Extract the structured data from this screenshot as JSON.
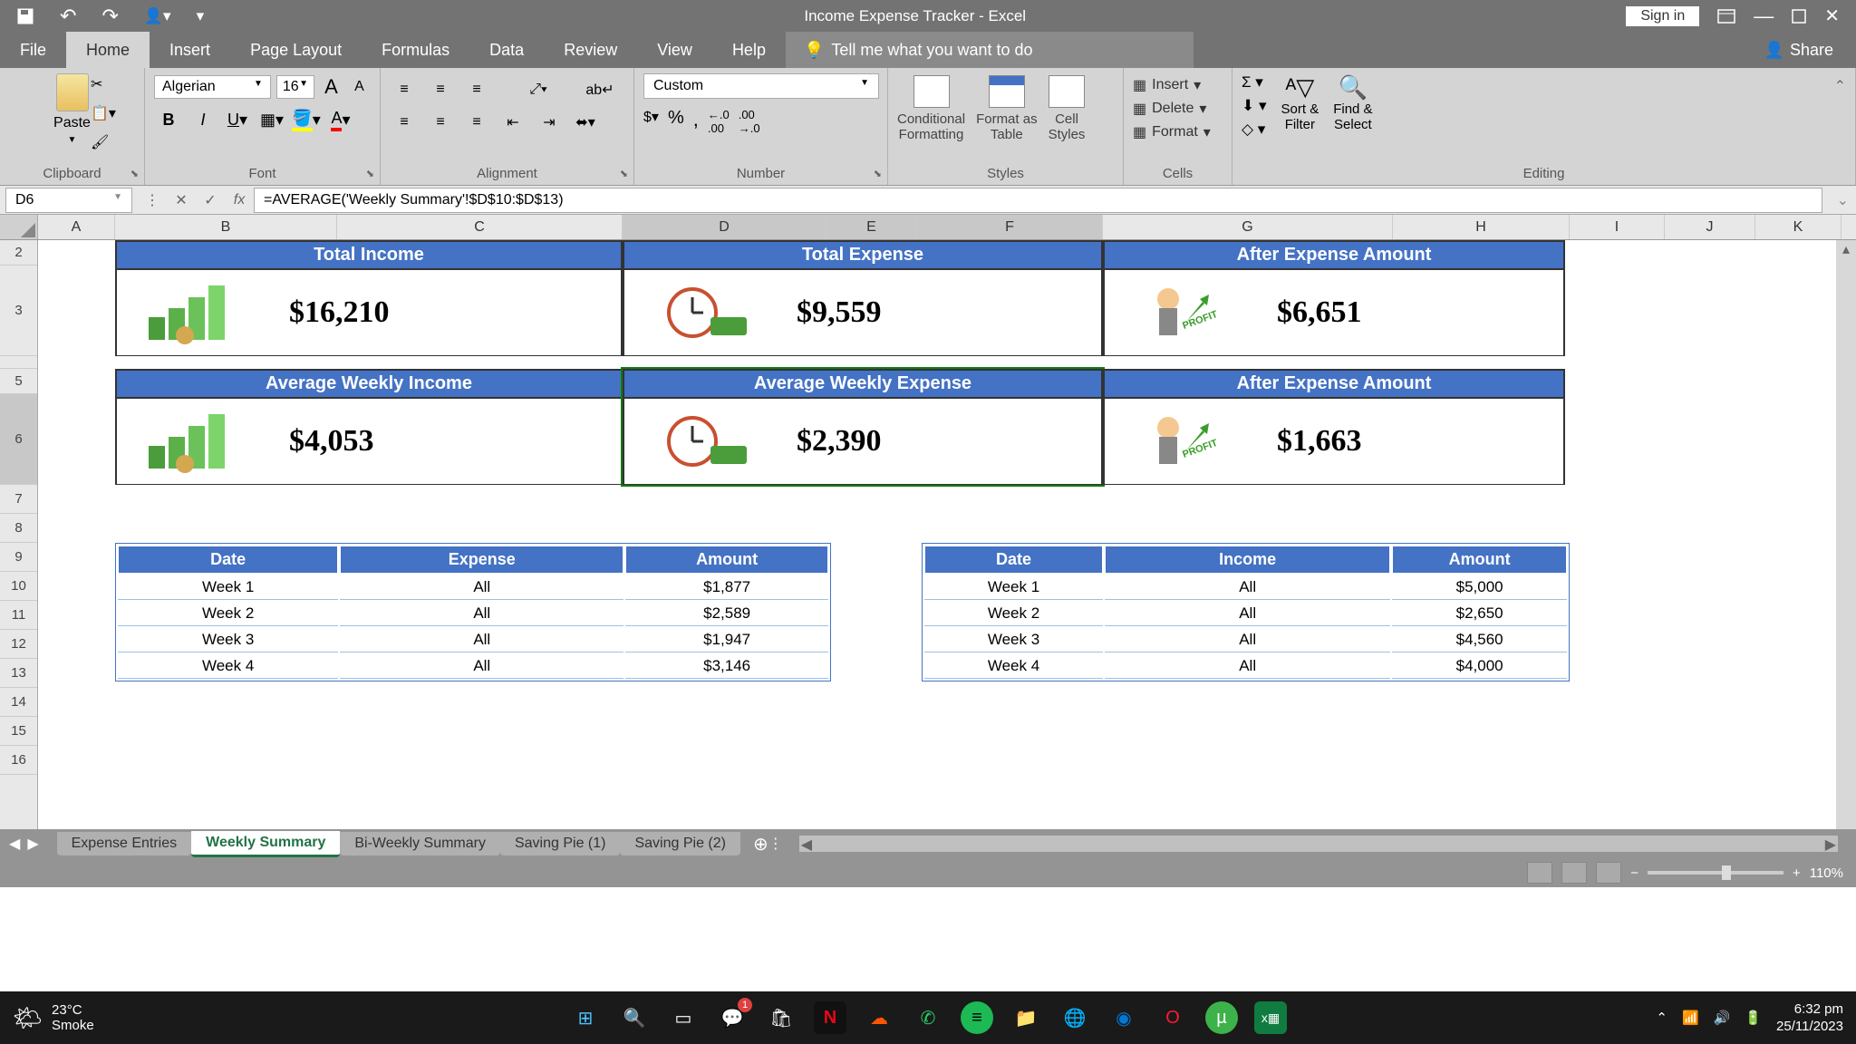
{
  "titlebar": {
    "title": "Income Expense Tracker  -  Excel",
    "signin": "Sign in"
  },
  "tabs": {
    "file": "File",
    "home": "Home",
    "insert": "Insert",
    "page_layout": "Page Layout",
    "formulas": "Formulas",
    "data": "Data",
    "review": "Review",
    "view": "View",
    "help": "Help",
    "tellme": "Tell me what you want to do",
    "share": "Share"
  },
  "ribbon": {
    "clipboard": {
      "paste": "Paste",
      "label": "Clipboard"
    },
    "font": {
      "name": "Algerian",
      "size": "16",
      "label": "Font"
    },
    "alignment": {
      "label": "Alignment"
    },
    "number": {
      "format": "Custom",
      "label": "Number"
    },
    "styles": {
      "cond": "Conditional Formatting",
      "cond1": "Conditional",
      "cond2": "Formatting",
      "table1": "Format as",
      "table2": "Table",
      "cell1": "Cell",
      "cell2": "Styles",
      "label": "Styles"
    },
    "cells": {
      "insert": "Insert",
      "delete": "Delete",
      "format": "Format",
      "label": "Cells"
    },
    "editing": {
      "sort1": "Sort &",
      "sort2": "Filter",
      "find1": "Find &",
      "find2": "Select",
      "label": "Editing"
    }
  },
  "formula": {
    "cell": "D6",
    "value": "=AVERAGE('Weekly Summary'!$D$10:$D$13)"
  },
  "cols": [
    "A",
    "B",
    "C",
    "D",
    "E",
    "F",
    "G",
    "H",
    "I",
    "J",
    "K"
  ],
  "summary": {
    "r1": [
      {
        "title": "Total Income",
        "value": "$16,210"
      },
      {
        "title": "Total Expense",
        "value": "$9,559"
      },
      {
        "title": "After Expense Amount",
        "value": "$6,651"
      }
    ],
    "r2": [
      {
        "title": "Average Weekly Income",
        "value": "$4,053"
      },
      {
        "title": "Average Weekly Expense",
        "value": "$2,390"
      },
      {
        "title": "After Expense Amount",
        "value": "$1,663"
      }
    ]
  },
  "expense_table": {
    "headers": [
      "Date",
      "Expense",
      "Amount"
    ],
    "rows": [
      [
        "Week 1",
        "All",
        "$1,877"
      ],
      [
        "Week 2",
        "All",
        "$2,589"
      ],
      [
        "Week 3",
        "All",
        "$1,947"
      ],
      [
        "Week 4",
        "All",
        "$3,146"
      ]
    ]
  },
  "income_table": {
    "headers": [
      "Date",
      "Income",
      "Amount"
    ],
    "rows": [
      [
        "Week 1",
        "All",
        "$5,000"
      ],
      [
        "Week 2",
        "All",
        "$2,650"
      ],
      [
        "Week 3",
        "All",
        "$4,560"
      ],
      [
        "Week 4",
        "All",
        "$4,000"
      ]
    ]
  },
  "sheets": [
    "Expense Entries",
    "Weekly Summary",
    "Bi-Weekly Summary",
    "Saving Pie (1)",
    "Saving Pie (2)"
  ],
  "zoom": "110%",
  "taskbar": {
    "temp": "23°C",
    "cond": "Smoke",
    "time": "6:32 pm",
    "date": "25/11/2023"
  }
}
